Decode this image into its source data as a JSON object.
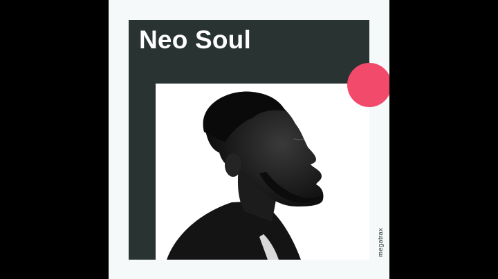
{
  "cover": {
    "title": "Neo Soul",
    "brand": "megatrax"
  },
  "colors": {
    "letterbox": "#000000",
    "background": "#f5f9fa",
    "frame": "#283332",
    "accent": "#f24a6b",
    "title_text": "#ffffff"
  },
  "photo": {
    "subject": "portrait-profile-photo"
  }
}
